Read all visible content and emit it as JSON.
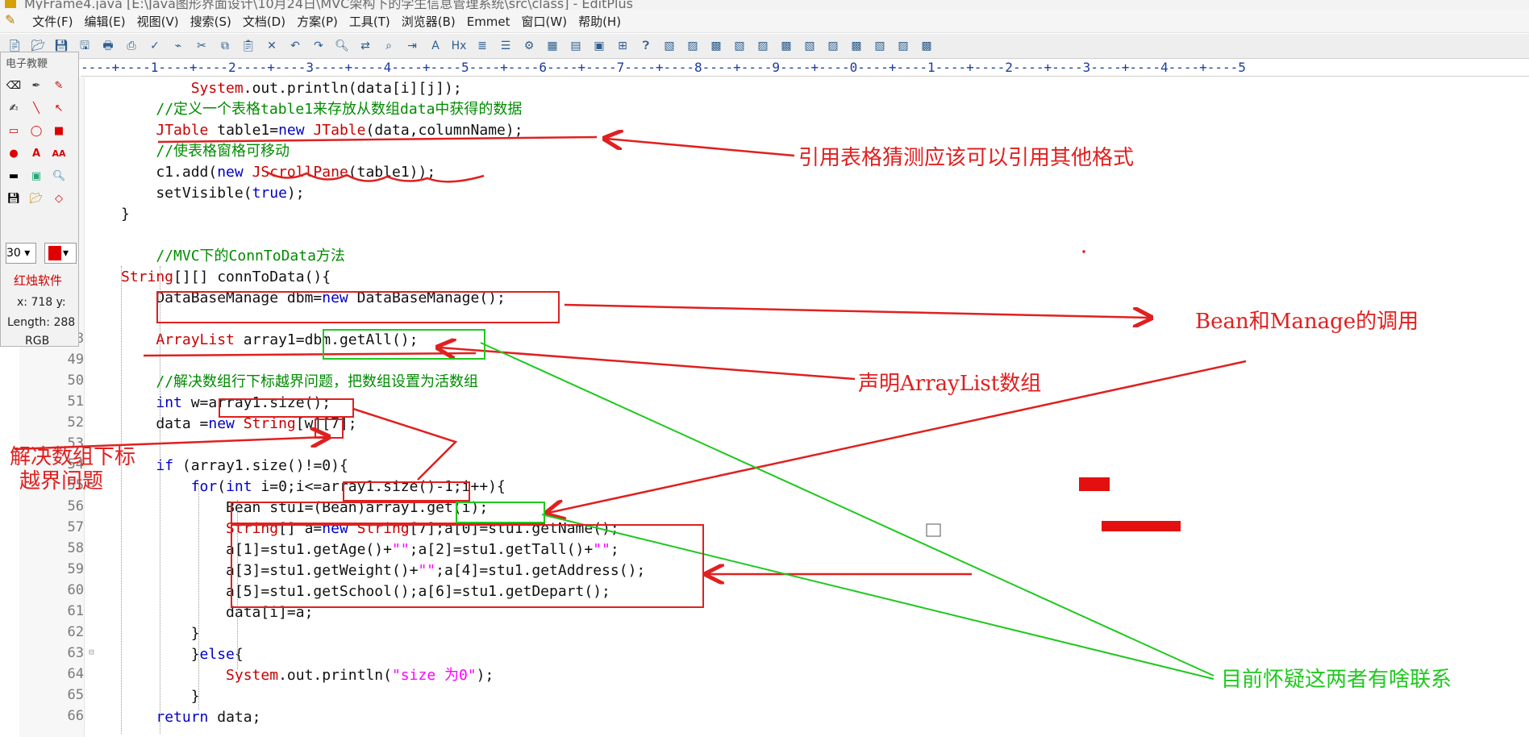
{
  "window": {
    "title": "MyFrame4.java [E:\\Java图形界面设计\\10月24日\\MVC架构下的学生信息管理系统\\src\\class] - EditPlus"
  },
  "menu": {
    "items": [
      "文件(F)",
      "编辑(E)",
      "视图(V)",
      "搜索(S)",
      "文档(D)",
      "方案(P)",
      "工具(T)",
      "浏览器(B)",
      "Emmet",
      "窗口(W)",
      "帮助(H)"
    ]
  },
  "ruler": {
    "text": "----+----1----+----2----+----3----+----4----+----5----+----6----+----7----+----8----+----9----+----0----+----1----+----2----+----3----+----4----+----5"
  },
  "editor": {
    "line_numbers": [
      "48",
      "49",
      "50",
      "51",
      "52",
      "53",
      "54",
      "55",
      "56",
      "57",
      "58",
      "59",
      "60",
      "61",
      "62",
      "63",
      "64",
      "65",
      "66"
    ],
    "lines": [
      [
        {
          "t": "        "
        },
        {
          "t": "System",
          "c": "ty"
        },
        {
          "t": ".out.println(data[i][j]);"
        }
      ],
      [
        {
          "t": "    "
        },
        {
          "t": "//定义一个表格table1来存放从数组data中获得的数据",
          "c": "cm"
        }
      ],
      [
        {
          "t": "    "
        },
        {
          "t": "JTable",
          "c": "ty"
        },
        {
          "t": " table1="
        },
        {
          "t": "new",
          "c": "kw"
        },
        {
          "t": " "
        },
        {
          "t": "JTable",
          "c": "ty"
        },
        {
          "t": "(data,columnName);"
        }
      ],
      [
        {
          "t": "    "
        },
        {
          "t": "//使表格窗格可移动",
          "c": "cm"
        }
      ],
      [
        {
          "t": "    c1.add("
        },
        {
          "t": "new",
          "c": "kw"
        },
        {
          "t": " "
        },
        {
          "t": "JScrollPane",
          "c": "ty"
        },
        {
          "t": "(table1));"
        }
      ],
      [
        {
          "t": "    setVisible("
        },
        {
          "t": "true",
          "c": "kw"
        },
        {
          "t": ");"
        }
      ],
      [
        {
          "t": "}"
        }
      ],
      [
        {
          "t": ""
        }
      ],
      [
        {
          "t": "    "
        },
        {
          "t": "//MVC下的ConnToData方法",
          "c": "cm"
        }
      ],
      [
        {
          "t": "String",
          "c": "ty"
        },
        {
          "t": "[][] connToData(){"
        }
      ],
      [
        {
          "t": "    DataBaseManage dbm="
        },
        {
          "t": "new",
          "c": "kw"
        },
        {
          "t": " DataBaseManage();"
        }
      ],
      [
        {
          "t": ""
        }
      ],
      [
        {
          "t": "    "
        },
        {
          "t": "ArrayList",
          "c": "ty"
        },
        {
          "t": " array1=dbm.getAll();"
        }
      ],
      [
        {
          "t": ""
        }
      ],
      [
        {
          "t": "    "
        },
        {
          "t": "//解决数组行下标越界问题，把数组设置为活数组",
          "c": "cm"
        }
      ],
      [
        {
          "t": "    "
        },
        {
          "t": "int",
          "c": "kw"
        },
        {
          "t": " w=array1.size();"
        }
      ],
      [
        {
          "t": "    data ="
        },
        {
          "t": "new",
          "c": "kw"
        },
        {
          "t": " "
        },
        {
          "t": "String",
          "c": "ty"
        },
        {
          "t": "[w][7];"
        }
      ],
      [
        {
          "t": ""
        }
      ],
      [
        {
          "t": "    "
        },
        {
          "t": "if",
          "c": "kw"
        },
        {
          "t": " (array1.size()!=0){"
        }
      ],
      [
        {
          "t": "        "
        },
        {
          "t": "for",
          "c": "kw"
        },
        {
          "t": "("
        },
        {
          "t": "int",
          "c": "kw"
        },
        {
          "t": " i=0;i<=array1.size()-1;i++){"
        }
      ],
      [
        {
          "t": "            Bean stu1=(Bean)array1.get(i);"
        }
      ],
      [
        {
          "t": "            "
        },
        {
          "t": "String",
          "c": "ty"
        },
        {
          "t": "[] a="
        },
        {
          "t": "new",
          "c": "kw"
        },
        {
          "t": " "
        },
        {
          "t": "String",
          "c": "ty"
        },
        {
          "t": "[7];a[0]=stu1.getName();"
        }
      ],
      [
        {
          "t": "            a[1]=stu1.getAge()+"
        },
        {
          "t": "\"\"",
          "c": "st"
        },
        {
          "t": ";a[2]=stu1.getTall()+"
        },
        {
          "t": "\"\"",
          "c": "st"
        },
        {
          "t": ";"
        }
      ],
      [
        {
          "t": "            a[3]=stu1.getWeight()+"
        },
        {
          "t": "\"\"",
          "c": "st"
        },
        {
          "t": ";a[4]=stu1.getAddress();"
        }
      ],
      [
        {
          "t": "            a[5]=stu1.getSchool();a[6]=stu1.getDepart();"
        }
      ],
      [
        {
          "t": "            data[i]=a;"
        }
      ],
      [
        {
          "t": "        }"
        }
      ],
      [
        {
          "t": "        }"
        },
        {
          "t": "else",
          "c": "kw"
        },
        {
          "t": "{"
        }
      ],
      [
        {
          "t": "            "
        },
        {
          "t": "System",
          "c": "ty"
        },
        {
          "t": ".out.println("
        },
        {
          "t": "\"size 为0\"",
          "c": "st"
        },
        {
          "t": ");"
        }
      ],
      [
        {
          "t": "        }"
        }
      ],
      [
        {
          "t": "    "
        },
        {
          "t": "return",
          "c": "kw"
        },
        {
          "t": " data;"
        }
      ]
    ]
  },
  "palette": {
    "title": "电子教鞭",
    "size_value": "30",
    "brand": "红烛软件",
    "coords": "x: 718  y:",
    "length": "Length: 288",
    "mode": "RGB"
  },
  "annotations": {
    "a1": "引用表格猜测应该可以引用其他格式",
    "a2": "Bean和Manage的调用",
    "a3": "声明ArrayList数组",
    "a4_line1": "解决数组下标",
    "a4_line2": "越界问题",
    "a5": "目前怀疑这两者有啥联系"
  },
  "colors": {
    "annotation_red": "#e02020",
    "annotation_green": "#1fc81f",
    "keyword": "#0000c8",
    "type": "#c80000",
    "comment": "#008c00",
    "string": "#ff00ff"
  }
}
